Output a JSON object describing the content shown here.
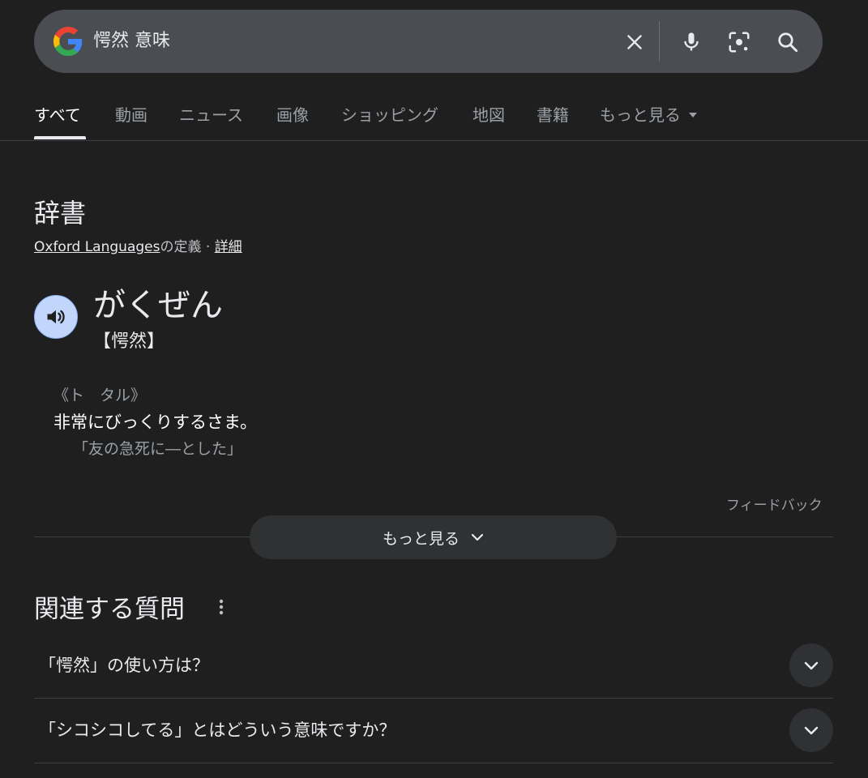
{
  "search": {
    "query": "愕然 意味",
    "icons": [
      "google-logo",
      "clear-icon",
      "mic-icon",
      "lens-icon",
      "search-icon"
    ]
  },
  "tabs": [
    {
      "label": "すべて",
      "active": true
    },
    {
      "label": "動画"
    },
    {
      "label": "ニュース"
    },
    {
      "label": "画像"
    },
    {
      "label": "ショッピング"
    },
    {
      "label": "地図"
    },
    {
      "label": "書籍"
    },
    {
      "label": "もっと見る"
    }
  ],
  "dictionary": {
    "heading": "辞書",
    "source_link": "Oxford Languages",
    "source_suffix": "の定義 · ",
    "details_link": "詳細",
    "reading": "がくぜん",
    "kanji": "【愕然】",
    "pos": "《ト　タル》",
    "definition": "非常にびっくりするさま。",
    "example": "「友の急死に―とした」",
    "feedback": "フィードバック",
    "more_label": "もっと見る"
  },
  "related": {
    "heading": "関連する質問",
    "questions": [
      "「愕然」の使い方は？",
      "「シコシコしてる」とはどういう意味ですか？"
    ]
  },
  "colors": {
    "background": "#1f1f1f",
    "search_bar": "#4a4d51",
    "audio_button": "#c2d5fb"
  }
}
